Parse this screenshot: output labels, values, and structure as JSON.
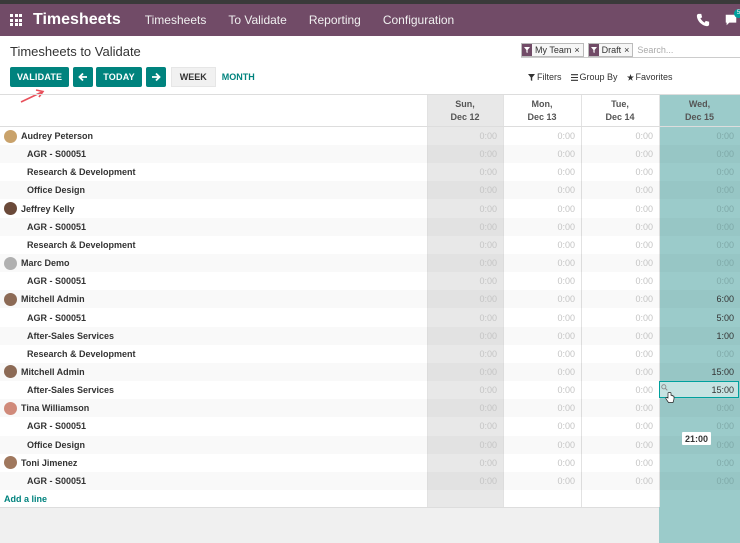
{
  "navbar": {
    "brand": "Timesheets",
    "menu": [
      "Timesheets",
      "To Validate",
      "Reporting",
      "Configuration"
    ],
    "chat_badge": "5"
  },
  "control_panel": {
    "title": "Timesheets to Validate",
    "facets": [
      {
        "label": "My Team"
      },
      {
        "label": "Draft"
      }
    ],
    "search_placeholder": "Search...",
    "buttons": {
      "validate": "VALIDATE",
      "today": "TODAY",
      "week": "WEEK",
      "month": "MONTH"
    },
    "options": {
      "filters": "Filters",
      "group_by": "Group By",
      "favorites": "Favorites"
    }
  },
  "grid": {
    "columns": [
      {
        "day": "Sun,",
        "date": "Dec 12"
      },
      {
        "day": "Mon,",
        "date": "Dec 13"
      },
      {
        "day": "Tue,",
        "date": "Dec 14"
      },
      {
        "day": "Wed,",
        "date": "Dec 15"
      }
    ],
    "rows": [
      {
        "label": "Audrey Peterson",
        "type": "employee",
        "values": [
          "0:00",
          "0:00",
          "0:00",
          "0:00"
        ]
      },
      {
        "label": "AGR - S00051",
        "type": "task",
        "values": [
          "0:00",
          "0:00",
          "0:00",
          "0:00"
        ]
      },
      {
        "label": "Research & Development",
        "type": "task",
        "values": [
          "0:00",
          "0:00",
          "0:00",
          "0:00"
        ]
      },
      {
        "label": "Office Design",
        "type": "task",
        "values": [
          "0:00",
          "0:00",
          "0:00",
          "0:00"
        ]
      },
      {
        "label": "Jeffrey Kelly",
        "type": "employee",
        "values": [
          "0:00",
          "0:00",
          "0:00",
          "0:00"
        ]
      },
      {
        "label": "AGR - S00051",
        "type": "task",
        "values": [
          "0:00",
          "0:00",
          "0:00",
          "0:00"
        ]
      },
      {
        "label": "Research & Development",
        "type": "task",
        "values": [
          "0:00",
          "0:00",
          "0:00",
          "0:00"
        ]
      },
      {
        "label": "Marc Demo",
        "type": "employee",
        "values": [
          "0:00",
          "0:00",
          "0:00",
          "0:00"
        ]
      },
      {
        "label": "AGR - S00051",
        "type": "task",
        "values": [
          "0:00",
          "0:00",
          "0:00",
          "0:00"
        ]
      },
      {
        "label": "Mitchell Admin",
        "type": "employee",
        "values": [
          "0:00",
          "0:00",
          "0:00",
          "6:00"
        ]
      },
      {
        "label": "AGR - S00051",
        "type": "task",
        "values": [
          "0:00",
          "0:00",
          "0:00",
          "5:00"
        ]
      },
      {
        "label": "After-Sales Services",
        "type": "task",
        "values": [
          "0:00",
          "0:00",
          "0:00",
          "1:00"
        ]
      },
      {
        "label": "Research & Development",
        "type": "task",
        "values": [
          "0:00",
          "0:00",
          "0:00",
          "0:00"
        ]
      },
      {
        "label": "Mitchell Admin",
        "type": "employee",
        "values": [
          "0:00",
          "0:00",
          "0:00",
          "15:00"
        ]
      },
      {
        "label": "After-Sales Services",
        "type": "task",
        "values": [
          "0:00",
          "0:00",
          "0:00",
          "15:00"
        ],
        "active": true
      },
      {
        "label": "Tina Williamson",
        "type": "employee",
        "values": [
          "0:00",
          "0:00",
          "0:00",
          "0:00"
        ]
      },
      {
        "label": "AGR - S00051",
        "type": "task",
        "values": [
          "0:00",
          "0:00",
          "0:00",
          "0:00"
        ]
      },
      {
        "label": "Office Design",
        "type": "task",
        "values": [
          "0:00",
          "0:00",
          "0:00",
          "0:00"
        ]
      },
      {
        "label": "Toni Jimenez",
        "type": "employee",
        "values": [
          "0:00",
          "0:00",
          "0:00",
          "0:00"
        ]
      },
      {
        "label": "AGR - S00051",
        "type": "task",
        "values": [
          "0:00",
          "0:00",
          "0:00",
          "0:00"
        ]
      }
    ],
    "add_line": "Add a line",
    "total": "21:00"
  },
  "colors": {
    "navbar": "#714b67",
    "primary": "#00837e",
    "today_column": "#9bcbca"
  }
}
